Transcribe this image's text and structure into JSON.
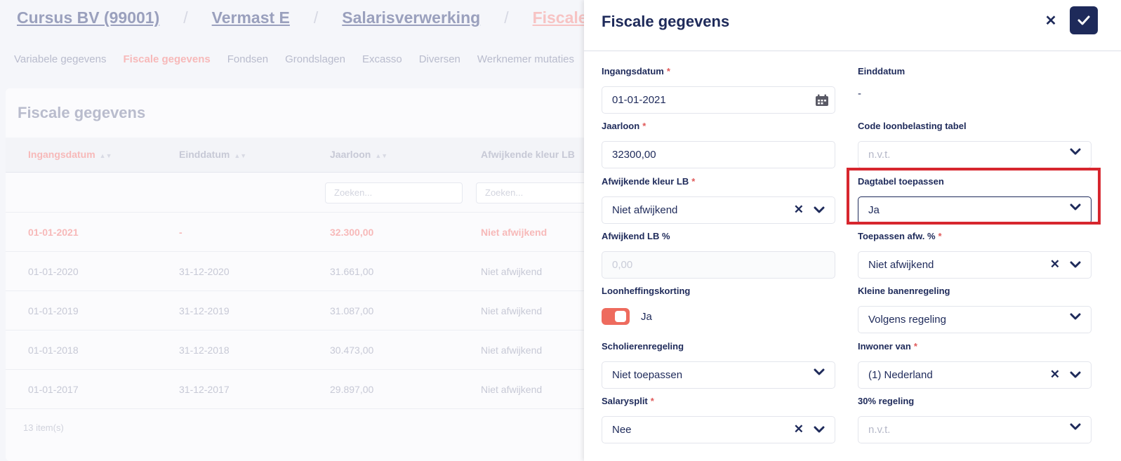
{
  "breadcrumb": [
    "Cursus BV (99001)",
    "Vermast E",
    "Salarisverwerking",
    "Fiscale gegevens"
  ],
  "subnav": [
    "Variabele gegevens",
    "Fiscale gegevens",
    "Fondsen",
    "Grondslagen",
    "Excasso",
    "Diversen",
    "Werknemer mutaties"
  ],
  "table": {
    "title": "Fiscale gegevens",
    "columns": [
      "Ingangsdatum",
      "Einddatum",
      "Jaarloon",
      "Afwijkende kleur LB"
    ],
    "filter_placeholder": "Zoeken...",
    "rows": [
      [
        "01-01-2021",
        "-",
        "32.300,00",
        "Niet afwijkend"
      ],
      [
        "01-01-2020",
        "31-12-2020",
        "31.661,00",
        "Niet afwijkend"
      ],
      [
        "01-01-2019",
        "31-12-2019",
        "31.087,00",
        "Niet afwijkend"
      ],
      [
        "01-01-2018",
        "31-12-2018",
        "30.473,00",
        "Niet afwijkend"
      ],
      [
        "01-01-2017",
        "31-12-2017",
        "29.897,00",
        "Niet afwijkend"
      ]
    ],
    "count": "13 item(s)"
  },
  "panel": {
    "title": "Fiscale gegevens",
    "close_label": "✕",
    "fields": {
      "ingangsdatum": {
        "label": "Ingangsdatum",
        "value": "01-01-2021"
      },
      "einddatum": {
        "label": "Einddatum",
        "value": "-"
      },
      "jaarloon": {
        "label": "Jaarloon",
        "value": "32300,00"
      },
      "code_loonbelasting": {
        "label": "Code loonbelasting tabel",
        "placeholder": "n.v.t."
      },
      "afwijkende_kleur": {
        "label": "Afwijkende kleur LB",
        "value": "Niet afwijkend"
      },
      "dagtabel": {
        "label": "Dagtabel toepassen",
        "value": "Ja"
      },
      "afwijkend_lb": {
        "label": "Afwijkend LB %",
        "placeholder": "0,00"
      },
      "toepassen_afw": {
        "label": "Toepassen afw. %",
        "value": "Niet afwijkend"
      },
      "loonheffingskorting": {
        "label": "Loonheffingskorting",
        "value": "Ja"
      },
      "kleine_banen": {
        "label": "Kleine banenregeling",
        "value": "Volgens regeling"
      },
      "scholieren": {
        "label": "Scholierenregeling",
        "value": "Niet toepassen"
      },
      "inwoner": {
        "label": "Inwoner van",
        "value": "(1) Nederland"
      },
      "salarysplit": {
        "label": "Salarysplit",
        "value": "Nee"
      },
      "regeling30": {
        "label": "30% regeling",
        "placeholder": "n.v.t."
      }
    }
  },
  "colors": {
    "primary": "#1e2a5a",
    "accent": "#ee6b5e",
    "highlight": "#d7262e"
  }
}
